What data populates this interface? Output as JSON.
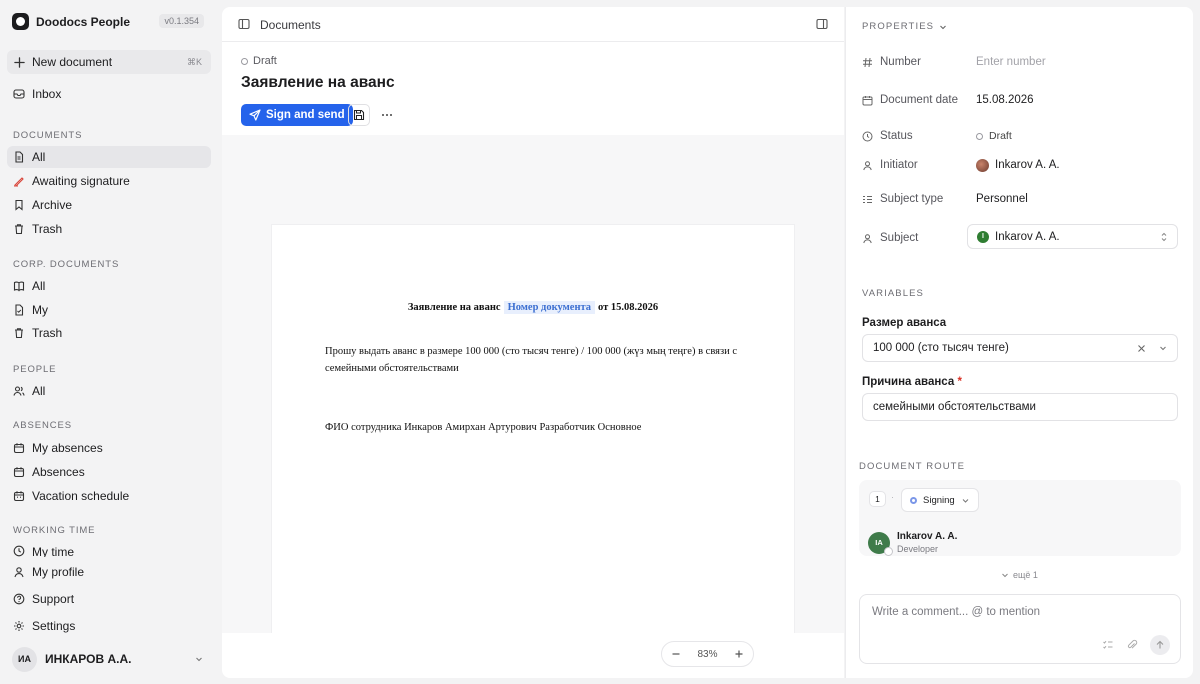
{
  "app": {
    "name": "Doodocs People",
    "version": "v0.1.354"
  },
  "sidebar": {
    "new_document": "New document",
    "new_document_shortcut": "⌘K",
    "inbox": "Inbox",
    "sections": {
      "documents": "DOCUMENTS",
      "corp_documents": "CORP. DOCUMENTS",
      "people": "PEOPLE",
      "absences": "ABSENCES",
      "working_time": "WORKING TIME"
    },
    "documents_items": [
      "All",
      "Awaiting signature",
      "Archive",
      "Trash"
    ],
    "corp_items": [
      "All",
      "My",
      "Trash"
    ],
    "people_items": [
      "All"
    ],
    "absences_items": [
      "My absences",
      "Absences",
      "Vacation schedule"
    ],
    "working_items": [
      "My time",
      "My profile"
    ],
    "support": "Support",
    "settings": "Settings",
    "user": {
      "initials": "ИА",
      "name": "ИНКАРОВ А.А."
    }
  },
  "main": {
    "breadcrumb": "Documents",
    "status": "Draft",
    "title": "Заявление на аванс",
    "sign_button": "Sign and send",
    "document": {
      "heading_pre": "Заявление на аванс",
      "heading_var": "Номер документа",
      "heading_post": "от 15.08.2026",
      "paragraph": "Прошу выдать аванс в размере 100 000 (сто тысяч тенге) / 100 000 (жүз мың теңге) в связи с семейными обстоятельствами",
      "signature_line": "ФИО сотрудника Инкаров Амирхан Артурович Разработчик Основное"
    },
    "zoom": "83%"
  },
  "panel": {
    "properties_label": "PROPERTIES",
    "number": {
      "label": "Number",
      "placeholder": "Enter number"
    },
    "document_date": {
      "label": "Document date",
      "value": "15.08.2026"
    },
    "status": {
      "label": "Status",
      "value": "Draft"
    },
    "initiator": {
      "label": "Initiator",
      "value": "Inkarov A. A."
    },
    "subject_type": {
      "label": "Subject type",
      "value": "Personnel"
    },
    "subject": {
      "label": "Subject",
      "value": "Inkarov A. A.",
      "avatar": "I"
    },
    "variables_label": "VARIABLES",
    "advance_amount": {
      "label": "Размер аванса",
      "value": "100 000 (сто тысяч тенге)"
    },
    "advance_reason": {
      "label": "Причина аванса",
      "required_mark": "*",
      "value": "семейными обстоятельствами"
    },
    "route_label": "DOCUMENT ROUTE",
    "route": {
      "step_number": "1",
      "step_type": "Signing",
      "person": {
        "initials": "IA",
        "name": "Inkarov A. A.",
        "role": "Developer"
      },
      "more": "ещё 1"
    },
    "comment_placeholder": "Write a comment... @ to mention"
  },
  "colors": {
    "accent": "#2563eb",
    "avatar_green": "#3f7b4a",
    "required": "#d93025"
  }
}
